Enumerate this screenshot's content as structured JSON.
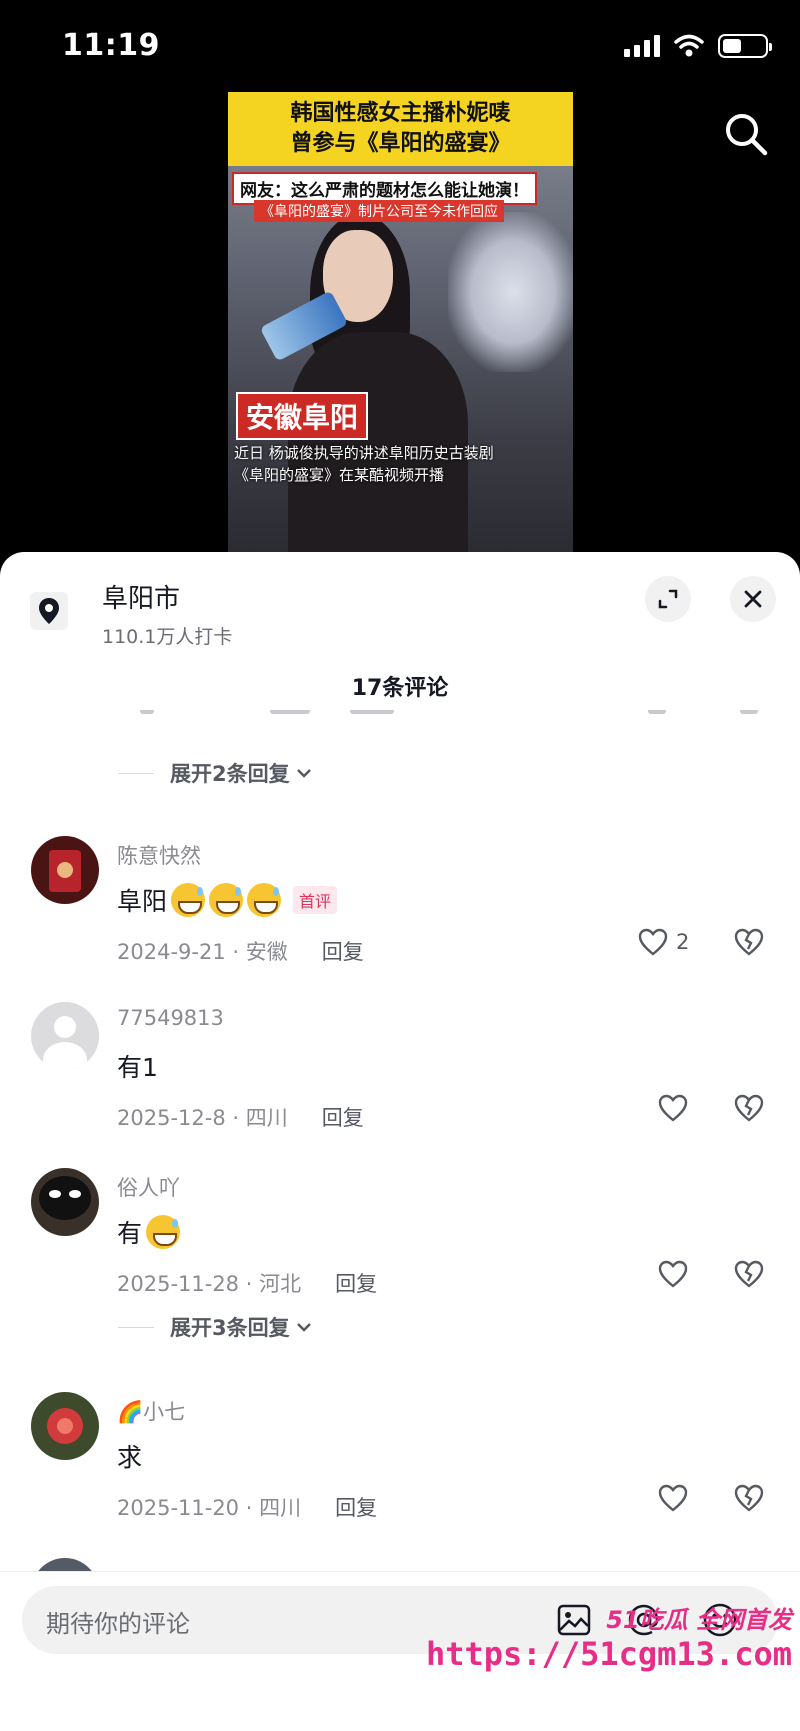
{
  "status_bar": {
    "time": "11:19"
  },
  "video": {
    "headline_1": "韩国性感女主播朴妮唛",
    "headline_2": "曾参与《阜阳的盛宴》",
    "caption_netizen": "网友：这么严肃的题材怎么能让她演！",
    "caption_company": "《阜阳的盛宴》制片公司至今未作回应",
    "caption_location": "安徽阜阳",
    "subtitle_1": "近日 杨诚俊执导的讲述阜阳历史古装剧",
    "subtitle_2": "《阜阳的盛宴》在某酷视频开播"
  },
  "sheet": {
    "location_name": "阜阳市",
    "location_checkins": "110.1万人打卡",
    "comment_count": "17条评论"
  },
  "expand_1": {
    "label": "展开2条回复"
  },
  "expand_2": {
    "label": "展开3条回复"
  },
  "comments": [
    {
      "user": "陈意快然",
      "text": "阜阳",
      "badge": "首评",
      "date": "2024-9-21 · 安徽",
      "reply": "回复",
      "likes": "2"
    },
    {
      "user": "77549813",
      "text": "有1",
      "date": "2025-12-8 · 四川",
      "reply": "回复"
    },
    {
      "user": "俗人吖",
      "text": "有",
      "date": "2025-11-28 · 河北",
      "reply": "回复"
    },
    {
      "user": "🌈小七",
      "text": "求",
      "date": "2025-11-20 · 四川",
      "reply": "回复"
    }
  ],
  "input": {
    "placeholder": "期待你的评论"
  },
  "watermark": {
    "top": "51吃瓜 全网首发",
    "url": "https://51cgm13.com"
  }
}
